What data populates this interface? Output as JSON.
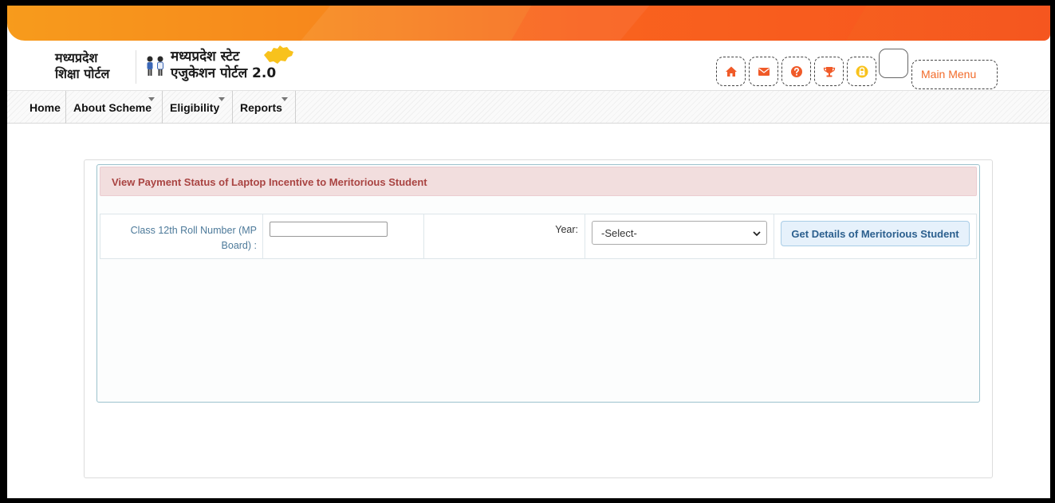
{
  "header": {
    "logo1_line1": "मध्यप्रदेश",
    "logo1_line2": "शिक्षा पोर्टल",
    "logo2_line1": "मध्यप्रदेश स्टेट",
    "logo2_line2": "एजुकेशन पोर्टल 2.0",
    "main_menu_label": "Main Menu",
    "icons": [
      "home-icon",
      "envelope-icon",
      "question-icon",
      "trophy-icon",
      "lock-icon"
    ],
    "accent_color": "#f26b2a"
  },
  "nav": {
    "items": [
      {
        "label": "Home"
      },
      {
        "label": "About Scheme"
      },
      {
        "label": "Eligibility"
      },
      {
        "label": "Reports"
      }
    ]
  },
  "panel": {
    "title": "View Payment Status of Laptop Incentive to Meritorious Student",
    "roll_label": "Class 12th Roll Number (MP Board) :",
    "roll_value": "",
    "year_label": "Year:",
    "year_selected": "-Select-",
    "submit_label": "Get Details of Meritorious Student"
  }
}
